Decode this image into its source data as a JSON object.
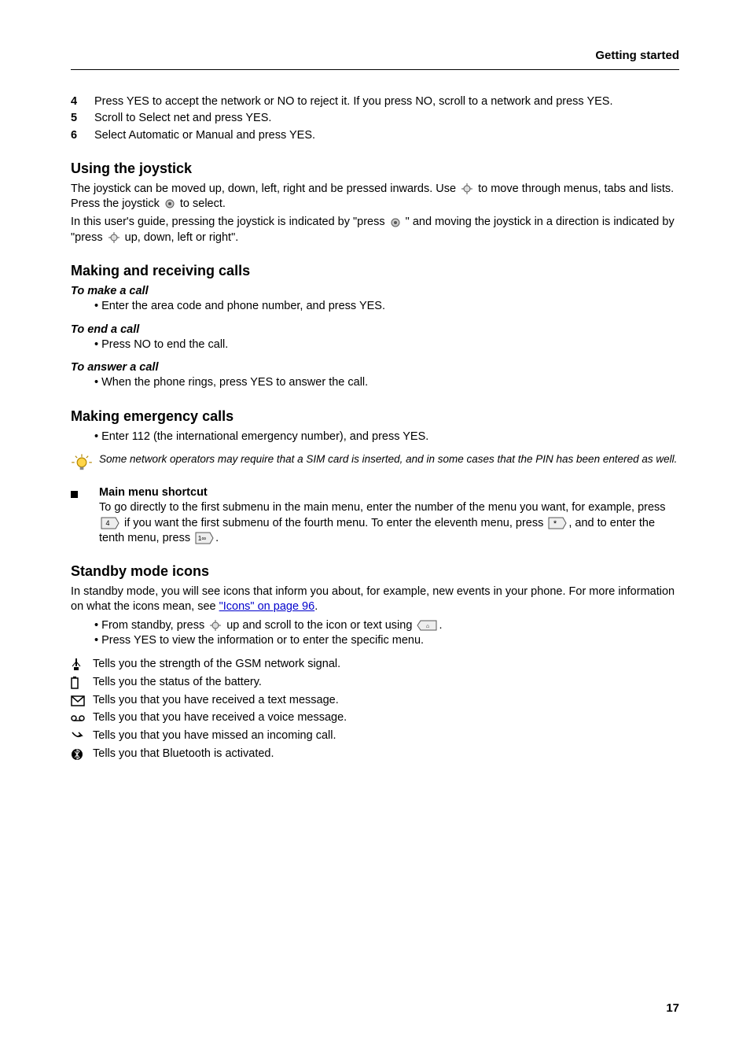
{
  "header": "Getting started",
  "page_number": "17",
  "s1": {
    "step4": "Press YES to accept the network or NO to reject it. If you press NO, scroll to a network and press YES.",
    "step5": "Scroll to Select net and press YES.",
    "step6": "Select Automatic or Manual and press YES."
  },
  "s2": {
    "title": "Using the joystick",
    "p1_a": "The joystick can be moved up, down, left, right and be pressed inwards. Use",
    "p1_b": "to move through menus, tabs and lists. Press the joystick",
    "p1_c": "to select.",
    "p2_a": "In this user's guide, pressing the joystick is indicated by \"press",
    "p2_b": "\" and moving the joystick in a direction is indicated by \"press",
    "p2_c": "up, down, left or right\"."
  },
  "s3": {
    "title": "Making and receiving calls",
    "step_make": "Enter the area code and phone number, and press YES.",
    "step_end": "Press NO to end the call.",
    "step_answer": "When the phone rings, press YES to answer the call."
  },
  "s4": {
    "title": "Making emergency calls",
    "step1": "Enter 112 (the international emergency number), and press YES.",
    "tip": "Some network operators may require that a SIM card is inserted, and in some cases that the PIN has been entered as well."
  },
  "s5": {
    "title": "Main menu shortcut",
    "text_a": "To go directly to the first submenu in the main menu, enter the number of the menu you want, for example, press ",
    "text_b": " if you want the first submenu of the fourth menu. To enter the eleventh menu, press",
    "text_c": ", and to enter the tenth menu, press",
    "text_d": "."
  },
  "s6": {
    "title": "Standby mode icons",
    "intro_a": "In standby mode, you will see icons that inform you about, for example, new events in your phone. For more information on what the icons mean, see ",
    "intro_link": "\"Icons\" on page 96",
    "intro_b": ".",
    "step_a": "From standby, press ",
    "step_b": " up and scroll to the icon or text using ",
    "step_c": ".",
    "step_view": "Press YES to view the information or to enter the specific menu.",
    "icons": {
      "i1": "Tells you the strength of the GSM network signal.",
      "i2": "Tells you the status of the battery.",
      "i3": "Tells you that you have received a text message.",
      "i4": "Tells you that you have received a voice message.",
      "i5": "Tells you that you have missed an incoming call.",
      "i6": "Tells you that Bluetooth is activated."
    }
  }
}
